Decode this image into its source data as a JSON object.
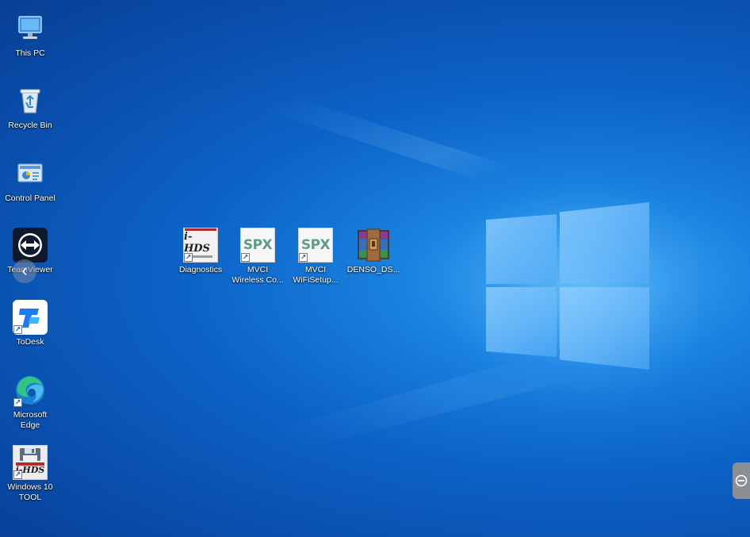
{
  "desktop": {
    "left_icons": [
      {
        "id": "this-pc",
        "label": "This PC",
        "icon": "computer-icon"
      },
      {
        "id": "recycle-bin",
        "label": "Recycle Bin",
        "icon": "recycle-bin-icon"
      },
      {
        "id": "control-panel",
        "label": "Control Panel",
        "icon": "control-panel-icon"
      },
      {
        "id": "teamviewer",
        "label": "TeamViewer",
        "icon": "teamviewer-icon"
      },
      {
        "id": "todesk",
        "label": "ToDesk",
        "icon": "todesk-icon"
      },
      {
        "id": "microsoft-edge",
        "label": "Microsoft\nEdge",
        "icon": "edge-icon"
      },
      {
        "id": "windows-10-tool",
        "label": "Windows 10\nTOOL",
        "icon": "ihds-floppy-icon"
      }
    ],
    "center_icons": [
      {
        "id": "diagnostics",
        "label": "Diagnostics",
        "icon": "ihds-icon",
        "tile_text": "i-HDS"
      },
      {
        "id": "mvci-wireless",
        "label": "MVCI\nWireless Co...",
        "icon": "spx-icon",
        "tile_text": "SPX"
      },
      {
        "id": "mvci-wifisetup",
        "label": "MVCI\nWiFiSetup...",
        "icon": "spx-icon",
        "tile_text": "SPX"
      },
      {
        "id": "denso-ds",
        "label": "DENSO_DS...",
        "icon": "winrar-archive-icon"
      }
    ],
    "tool_tile_text": "i-HDS",
    "side_handle_glyph": "‹",
    "colors": {
      "wallpaper_dark": "#073f95",
      "wallpaper_mid": "#0c63c7",
      "wallpaper_light": "#3fa8f2",
      "label_text": "#ffffff"
    }
  }
}
